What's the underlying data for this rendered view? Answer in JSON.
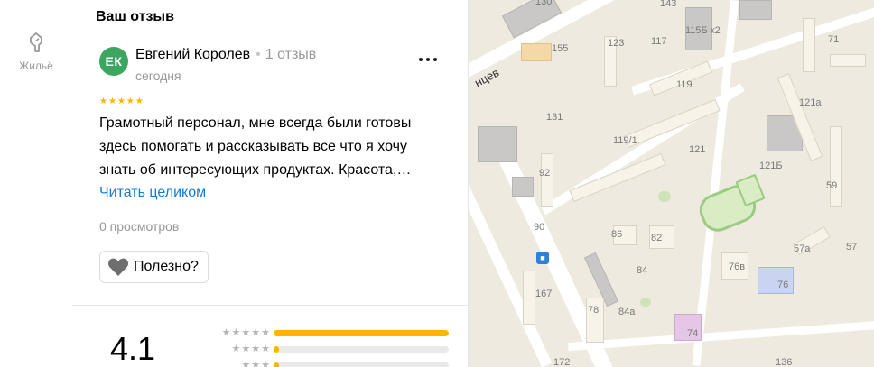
{
  "sidebar": {
    "items": [
      {
        "label": "Жильё",
        "icon": "building-icon"
      }
    ]
  },
  "review": {
    "section_title": "Ваш отзыв",
    "avatar_initials": "ЕК",
    "author_name": "Евгений Королев",
    "author_reviews_count": "1 отзыв",
    "date": "сегодня",
    "stars": 5,
    "text": "Грамотный персонал, мне всегда были готовы здесь помогать и рассказывать все что я хочу знать об интересующих продуктах. Красота,…",
    "read_more_label": "Читать целиком",
    "views": "0 просмотров",
    "helpful_label": "Полезно?"
  },
  "rating": {
    "value": "4.1",
    "distribution": [
      {
        "stars": 5,
        "fraction": 1.0,
        "color": "#fdb500"
      },
      {
        "stars": 4,
        "fraction": 0.03,
        "color": "#fdb500"
      },
      {
        "stars": 3,
        "fraction": 0.03,
        "color": "#fdb500"
      }
    ]
  },
  "map": {
    "street_label": "нцев",
    "house_numbers": [
      "130",
      "143",
      "115Б к2",
      "155",
      "123",
      "117",
      "71",
      "119",
      "131",
      "121а",
      "119/1",
      "121",
      "121Б",
      "92",
      "59",
      "90",
      "86",
      "82",
      "57а",
      "57",
      "84",
      "76в",
      "76",
      "167",
      "78",
      "84а",
      "74",
      "172",
      "136"
    ]
  },
  "colors": {
    "accent_link": "#1a7ad3",
    "star": "#fdb500",
    "avatar_bg": "#3aa660"
  }
}
